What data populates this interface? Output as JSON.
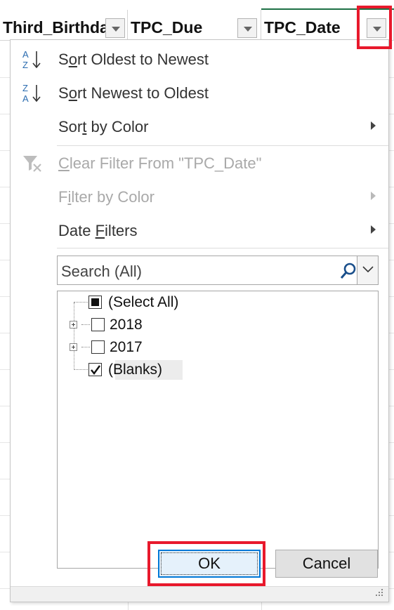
{
  "columns": [
    {
      "header": "Third_Birthday"
    },
    {
      "header": "TPC_Due"
    },
    {
      "header": "TPC_Date"
    }
  ],
  "menu": {
    "sort_asc": {
      "pre": "S",
      "ul": "o",
      "post": "rt Oldest to Newest"
    },
    "sort_desc": {
      "pre": "S",
      "ul": "o",
      "post": "rt Newest to Oldest"
    },
    "sort_color": {
      "pre": "Sor",
      "ul": "t",
      "post": " by Color"
    },
    "clear_filter": {
      "pre": "",
      "ul": "C",
      "post": "lear Filter From \"TPC_Date\""
    },
    "filter_color": {
      "pre": "F",
      "ul": "i",
      "post": "lter by Color"
    },
    "date_filters": {
      "pre": "Date ",
      "ul": "F",
      "post": "ilters"
    }
  },
  "sort_icon_letters": {
    "top": "A",
    "bottom": "Z"
  },
  "search": {
    "value": "Search (All)"
  },
  "tree": [
    {
      "label": "(Select All)",
      "state": "mixed"
    },
    {
      "label": "2018",
      "state": "unchecked"
    },
    {
      "label": "2017",
      "state": "unchecked"
    },
    {
      "label": "(Blanks)",
      "state": "checked"
    }
  ],
  "buttons": {
    "ok": "OK",
    "cancel": "Cancel"
  },
  "colors": {
    "highlight_red": "#e8192c",
    "focus_blue": "#0078d7",
    "sheet_green": "#1e7145"
  }
}
